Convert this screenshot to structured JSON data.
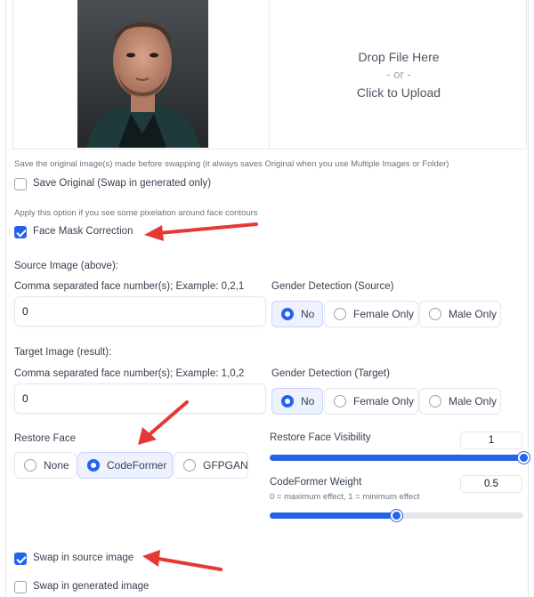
{
  "upload": {
    "drop_text": "Drop File Here",
    "or_text": "- or -",
    "click_text": "Click to Upload"
  },
  "save_original": {
    "hint": "Save the original image(s) made before swapping (it always saves Original when you use Multiple Images or Folder)",
    "label": "Save Original (Swap in generated only)",
    "checked": false
  },
  "face_mask": {
    "hint": "Apply this option if you see some pixelation around face contours",
    "label": "Face Mask Correction",
    "checked": true
  },
  "source": {
    "section_title": "Source Image (above):",
    "faces_label": "Comma separated face number(s); Example: 0,2,1",
    "faces_value": "0",
    "gender_label": "Gender Detection (Source)",
    "gender_options": [
      "No",
      "Female Only",
      "Male Only"
    ],
    "gender_selected": "No"
  },
  "target": {
    "section_title": "Target Image (result):",
    "faces_label": "Comma separated face number(s); Example: 1,0,2",
    "faces_value": "0",
    "gender_label": "Gender Detection (Target)",
    "gender_options": [
      "No",
      "Female Only",
      "Male Only"
    ],
    "gender_selected": "No"
  },
  "restore": {
    "label": "Restore Face",
    "options": [
      "None",
      "CodeFormer",
      "GFPGAN"
    ],
    "selected": "CodeFormer",
    "visibility_label": "Restore Face Visibility",
    "visibility_value": "1",
    "visibility_fraction": 1.0,
    "cf_weight_label": "CodeFormer Weight",
    "cf_weight_hint": "0 = maximum effect, 1 = minimum effect",
    "cf_weight_value": "0.5",
    "cf_weight_fraction": 0.5
  },
  "swap_source": {
    "label": "Swap in source image",
    "checked": true
  },
  "swap_generated": {
    "label": "Swap in generated image",
    "checked": false
  },
  "colors": {
    "accent": "#2563eb",
    "arrow": "#e53935"
  }
}
